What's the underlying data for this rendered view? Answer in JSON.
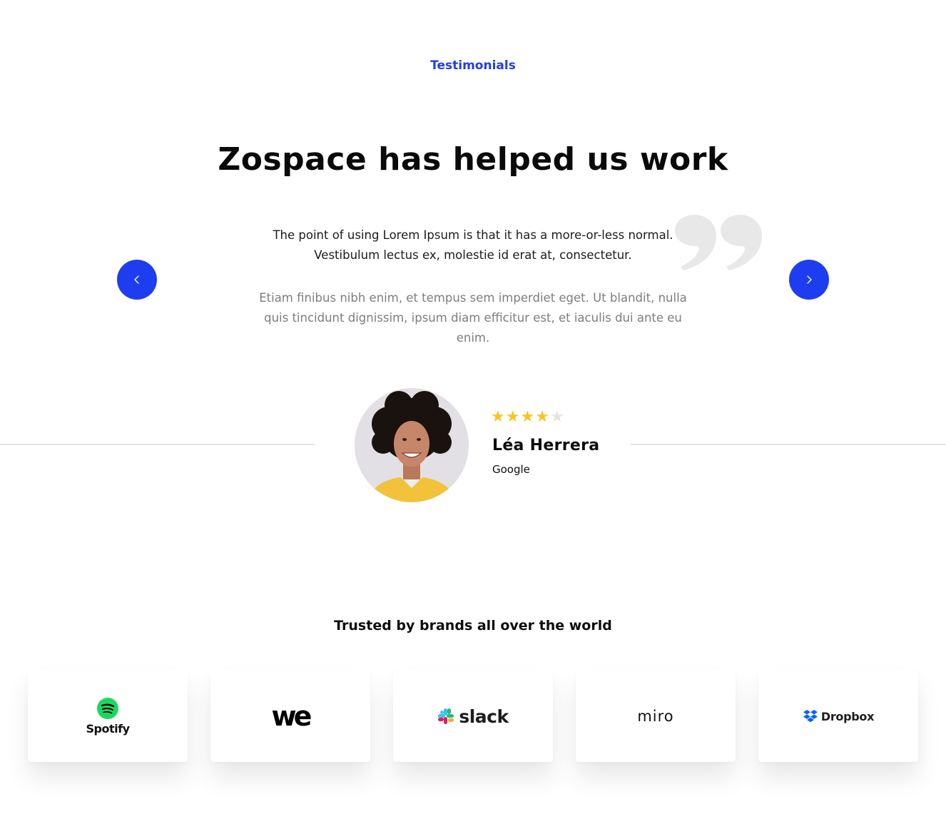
{
  "section_label": "Testimonials",
  "testimonial": {
    "headline": "Zospace has helped us work",
    "quote_glyph": "”",
    "lead": "The point of using Lorem Ipsum is that it has a more-or-less normal. Vestibulum lectus ex, molestie id erat at, consectetur.",
    "body": "Etiam finibus nibh enim, et tempus sem imperdiet eget. Ut blandit, nulla quis tincidunt dignissim, ipsum diam efficitur est, et iaculis dui ante eu enim.",
    "rating": 4,
    "rating_max": 5,
    "author": {
      "name": "Léa Herrera",
      "company": "Google"
    }
  },
  "carousel": {
    "prev_icon": "chevron-left-icon",
    "next_icon": "chevron-right-icon",
    "button_color": "#1f3df0"
  },
  "brands": {
    "title": "Trusted by brands all over the world",
    "logos": [
      {
        "name": "Spotify",
        "icon": "spotify-logo"
      },
      {
        "name": "we",
        "icon": "wetransfer-logo"
      },
      {
        "name": "slack",
        "icon": "slack-logo"
      },
      {
        "name": "miro",
        "icon": "miro-logo"
      },
      {
        "name": "Dropbox",
        "icon": "dropbox-logo"
      }
    ]
  },
  "colors": {
    "accent": "#1f3df0",
    "star": "#f7c520",
    "star_empty": "#e4e4e4",
    "muted_text": "#7d7d7d"
  }
}
